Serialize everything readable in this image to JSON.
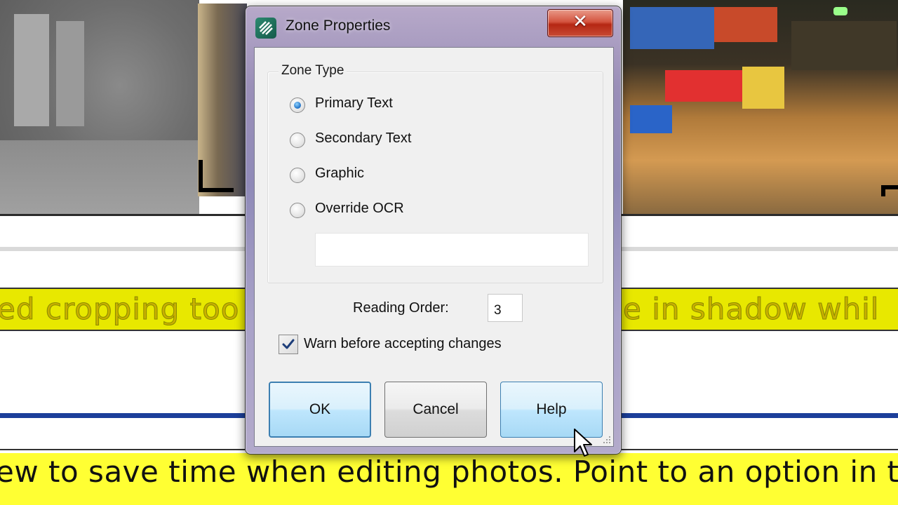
{
  "background": {
    "caption_top": "ed cropping too",
    "caption_top_right": "e in shadow whil",
    "caption_bottom": "ew to save time when editing photos. Point to an option in the"
  },
  "dialog": {
    "title": "Zone Properties",
    "close_glyph": "✕",
    "zone_type": {
      "label": "Zone Type",
      "options": [
        {
          "label": "Primary Text",
          "checked": true
        },
        {
          "label": "Secondary Text",
          "checked": false
        },
        {
          "label": "Graphic",
          "checked": false
        },
        {
          "label": "Override OCR",
          "checked": false
        }
      ],
      "override_value": ""
    },
    "reading_order": {
      "label": "Reading Order:",
      "value": "3"
    },
    "warn_checkbox": {
      "label": "Warn before accepting changes",
      "checked": true
    },
    "buttons": {
      "ok": "OK",
      "cancel": "Cancel",
      "help": "Help"
    }
  },
  "colors": {
    "caption_yellow": "#ffff33",
    "close_red": "#c0392b",
    "default_button_border": "#3c7fb1",
    "radio_selected": "#1f6fc4"
  },
  "icons": [
    "app-logo-icon",
    "close-icon",
    "check-icon",
    "resize-grip-icon",
    "mouse-pointer-icon"
  ]
}
